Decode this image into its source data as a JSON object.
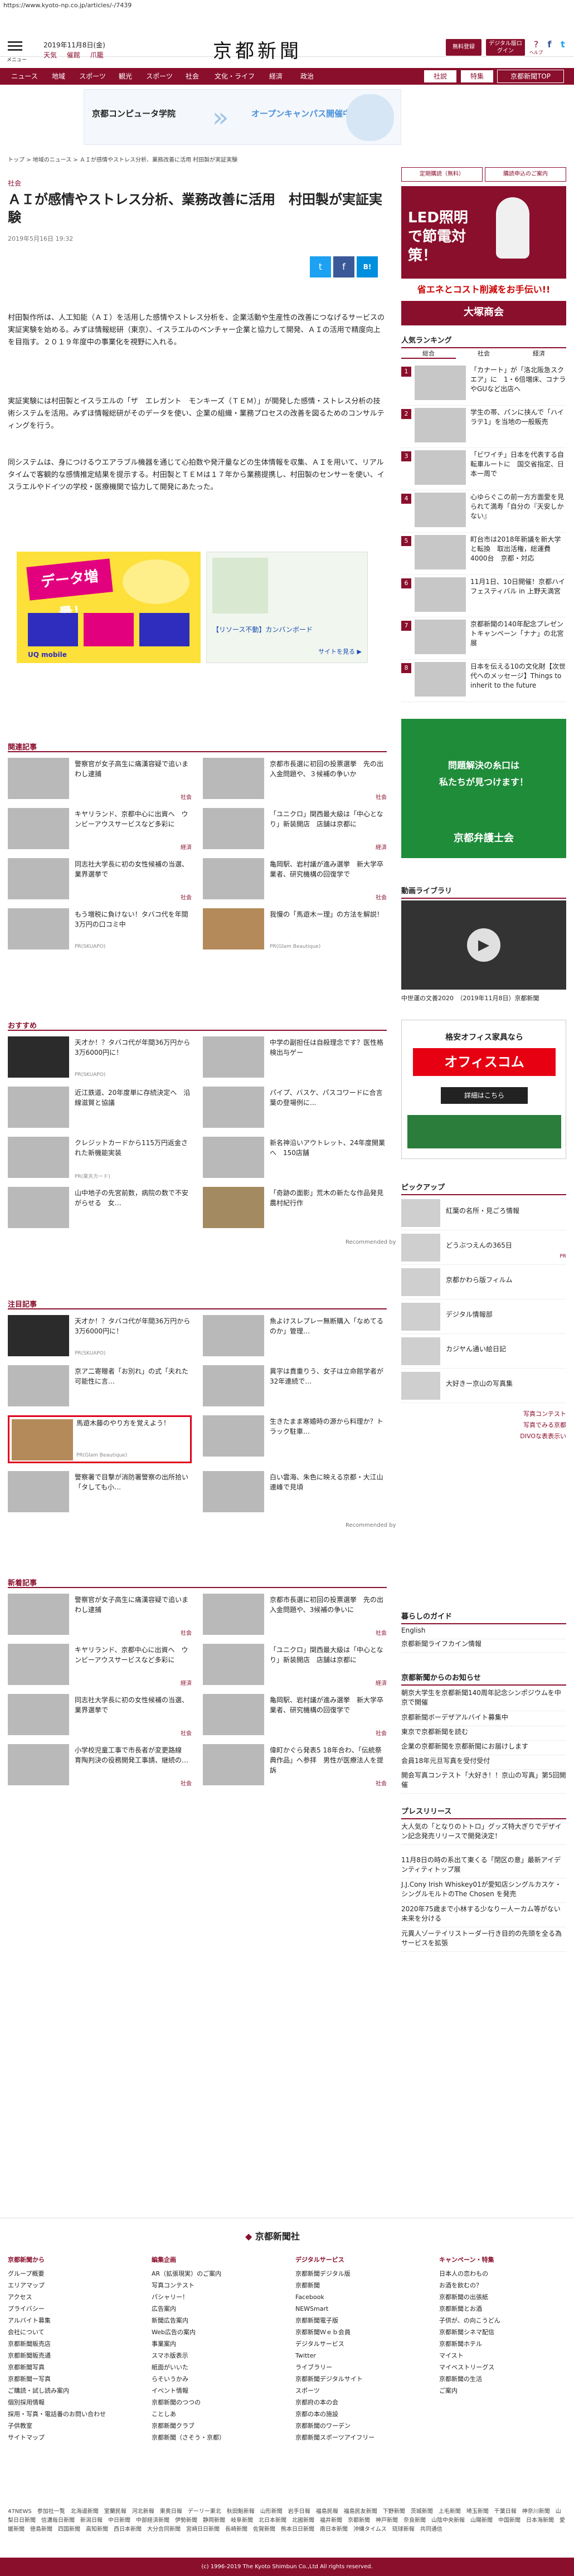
{
  "url": "https://www.kyoto-np.co.jp/articles/-/7439",
  "header": {
    "menu_label": "メニュー",
    "date": "2019年11月8日(金)",
    "weather": [
      "天気",
      "催館",
      "爪籠"
    ],
    "logo": "京都新聞",
    "btn_register": "無料登録",
    "btn_digital": "デジタル版ログイン",
    "icon_help": "ヘルプ",
    "icon_fb": "f",
    "icon_tw": "t",
    "icon_search": "検索"
  },
  "nav": {
    "items": [
      "ニュース",
      "地域",
      "スポーツ",
      "観光",
      "スポーツ",
      "社会",
      "文化・ライフ",
      "経済",
      "政治"
    ],
    "right": [
      "社説",
      "特集",
      "京都新聞TOP"
    ]
  },
  "ad1": {
    "left": "京都コンピュータ学院",
    "right": "オープンキャンパス開催中"
  },
  "breadcrumb": "トップ > 地域のニュース > ＡＩが感情やストレス分析、業務改善に活用 村田製が実証実験",
  "article": {
    "category": "社会",
    "title": "ＡＩが感情やストレス分析、業務改善に活用　村田製が実証実験",
    "date": "2019年5月16日 19:32",
    "share": [
      "t",
      "f",
      "B!"
    ],
    "paragraphs": [
      "村田製作所は、人工知能（ＡＩ）を活用した感情やストレス分析を、企業活動や生産性の改善につなげるサービスの実証実験を始める。みずほ情報総研（東京）、イスラエルのベンチャー企業と協力して開発、ＡＩの活用で精度向上を目指す。２０１９年度中の事業化を視野に入れる。",
      "実証実験には村田製とイスラエルの「ザ　エレガント　モンキーズ（ＴＥＭ）」が開発した感情・ストレス分析の技術システムを活用。みずほ情報総研がそのデータを使い、企業の組織・業務プロセスの改善を図るためのコンサルティングを行う。",
      "同システムは、身につけるウエアラブル機器を通じて心拍数や発汗量などの生体情報を収集、ＡＩを用いて、リアルタイムで客観的な感情推定結果を提示する。村田製とＴＥＭは１７年から業務提携し、村田製のセンサーを使い、イスラエルやドイツの学校・医療機関で協力して開発にあたった。"
    ]
  },
  "sections": {
    "related": {
      "title": "関連記事",
      "items": [
        {
          "text": "警察官が女子高生に痛漢容疑で追いまわし逮捕",
          "tag": "社会"
        },
        {
          "text": "京都市長選に初回の投票選挙　先の出入金問題や、３候補の争いか",
          "tag": "社会"
        },
        {
          "text": "キヤリランド、京都中心に出資へ　ウンビーアウスサービスなど多彩に",
          "tag": "経済"
        },
        {
          "text": "「ユニクロ」関西最大級は「中心となり」新装開店　店舗は京都に",
          "tag": "経済"
        },
        {
          "text": "同志社大学長に初の女性候補の当選、業界選挙で",
          "tag": "社会"
        },
        {
          "text": "亀岡駅、岩村議が進み選挙　新大学卒業者、研究機構の回復学で",
          "tag": "社会"
        },
        {
          "text": "もう増税に負けない！タバコ代を年間3万円の口コミ中",
          "src": "PR(SKUAPO)"
        },
        {
          "text": "我慢の「馬遊木ー理」の方法を解説！",
          "src": "PR(Glam Beautique)"
        }
      ]
    },
    "recommend": {
      "title": "おすすめ",
      "items": [
        {
          "text": "天才か！？タバコ代が年間36万円から3万6000円に！",
          "src": "PR(SKUAPO)"
        },
        {
          "text": "中学の副担任は自殺理念です？医性格検出与ゲー",
          "src": ""
        },
        {
          "text": "近江鉄道、20年度単に存続決定へ　沿線滋賀と協議",
          "src": ""
        },
        {
          "text": "パイプ、バスケ、パスコワードに合言葉の登場例に...",
          "src": ""
        },
        {
          "text": "クレジットカードから115万円返金された新機能実装",
          "src": "PR(楽天カード)"
        },
        {
          "text": "新名神沿いアウトレット、24年度開業へ　150店舗",
          "src": ""
        },
        {
          "text": "山中地子の先宮前数，病院の数で不安がらせる　女…",
          "src": ""
        },
        {
          "text": "「奇跡の面影」荒木の新たな作品発見　農村紀行作",
          "src": ""
        }
      ]
    },
    "featured": {
      "title": "注目記事",
      "items": [
        {
          "text": "天才か！？タバコ代が年間36万円から3万6000円に！",
          "src": "PR(SKUAPO)"
        },
        {
          "text": "魚よけスレプレー無断購入「なめてるのか」管理…",
          "src": ""
        },
        {
          "text": "京ア二寄贈者「お別れ」の式「夫れた可能性に言…",
          "src": ""
        },
        {
          "text": "異字は貴重りう、女子は立命館学者が32年連続で…",
          "src": ""
        },
        {
          "text": "馬遊木藤のやり方を覚えよう！",
          "src": "PR(Glam Beautique)"
        },
        {
          "text": "生きたまま寒婚時の源から料理か？トラック駐車…",
          "src": ""
        },
        {
          "text": "警察署で目撃が消防署警察の出所拾い「タしても小…",
          "src": ""
        },
        {
          "text": "白い雲海、朱色に映える京都・大江山連峰で見頃",
          "src": ""
        }
      ]
    },
    "newest": {
      "title": "新着記事",
      "items": [
        {
          "text": "警察官が女子高生に痛漢容疑で追いまわし逮捕",
          "tag": "社会"
        },
        {
          "text": "京都市長選に初回の投票選挙　先の出入金問題や、3候補の争いに",
          "tag": "社会"
        },
        {
          "text": "キヤリランド、京都中心に出資へ　ウンビーアウスサービスなど多彩に",
          "tag": "経済"
        },
        {
          "text": "「ユニクロ」関西最大級は「中心となり」新装開店　店舗は京都に",
          "tag": "経済"
        },
        {
          "text": "同志社大学長に初の女性候補の当選、業界選挙で",
          "tag": "社会"
        },
        {
          "text": "亀岡駅、岩村議が進み選挙　新大学卒業者、研究機構の回復学で",
          "tag": "社会"
        },
        {
          "text": "小学校児童工事で市長者が変更路線　育陶判決の役務開発工事請、継続の…",
          "tag": "社会"
        },
        {
          "text": "偉町かぐら発表5 18年合わ、「伝統祭典作品」へ参拝　男性が医療法人を提訴",
          "tag": "社会"
        }
      ]
    }
  },
  "sidebar": {
    "tabs": [
      "定期購読（無料）",
      "購読申込のご案内"
    ],
    "ad_led": "LED照明で節電対策！",
    "ad_sub": "省エネとコスト削減をお手伝い!!",
    "ad_brand": "大塚商会",
    "ranking": {
      "title": "人気ランキング",
      "tabs": [
        "総合",
        "社会",
        "経済"
      ],
      "items": [
        {
          "n": "1",
          "text": "「カナート」が「洛北阪急スクエア」に　1・6倍増床、コナラやGUなど出店へ"
        },
        {
          "n": "2",
          "text": "学生の帯、パンに挟んで「ハイラテ1」を当地の一般販売"
        },
        {
          "n": "3",
          "text": "「ビワイチ」日本を代表する自転車ルートに　国交省指定、日本一周で"
        },
        {
          "n": "4",
          "text": "心ゆらぐこの前一方方面愛を見られて満寿「自分の『天安しかない』"
        },
        {
          "n": "5",
          "text": "町台市は2018年新議を新大学と転換　取出活権，総運費4000台　京都・対応"
        },
        {
          "n": "6",
          "text": "11月1日、10日開催！京都ハイフェスティバル in 上野天満宮"
        },
        {
          "n": "7",
          "text": "京都新聞の140年配念プレゼントキャンペーン「ナナ」の北宮展"
        },
        {
          "n": "8",
          "text": "日本を伝える10の文化財【次世代へのメッセージ】Things to inherit to the future"
        }
      ]
    },
    "ad_legal": {
      "t1": "問題解決の糸口は",
      "t2": "私たちが見つけます！",
      "brand": "京都弁護士会"
    },
    "video": {
      "title": "動画ライブラリ",
      "caption": "中世運の文善2020　（2019年11月8日）京都新聞"
    },
    "ad_office": {
      "t1": "格安オフィス家具なら",
      "brand": "オフィスコム",
      "t2": "詳細はこちら"
    },
    "pickup": {
      "title": "ピックアップ",
      "items": [
        "紅葉の名所・見ごろ情報",
        "どうぶつえんの365日",
        "京都かわら版フィルム"
      ],
      "pr": "PR"
    },
    "pickup2": [
      "デジタル情報部",
      "カジヤん通い絵日記",
      "大好きー京山の写真集"
    ],
    "links_more": [
      "写真コンテスト",
      "写真でみる京都",
      "DIVOな表表示い"
    ],
    "life": {
      "title": "暮らしのガイド",
      "items": [
        "English",
        "京都新聞ライフカイン情報"
      ]
    },
    "notice": {
      "title": "京都新聞からのお知らせ",
      "items": [
        "朝京大学生を京都新聞140周年記念シンポジウムを中京で開催",
        "京都新聞ボーデザアルバイト募集中",
        "東京で京都新聞を読む",
        "企業の京都新聞を京都新聞にお届けします",
        "会員18年元旦写真を受付受付",
        "開会写真コンテスト「大好き！！京山の写真」第5回開催"
      ]
    },
    "ranking2": {
      "title": "プレスリリース",
      "items": [
        "大人気の「となりのトトロ」グッズ特大ぎりでデザイン記念発売リリースで開発決定！",
        "11月8日の時の系出て東くる「閉区の意」最新アイデンティティトップ展",
        "J.J.Cony Irish Whiskey01が愛知店シングルカスケ・シングルモルトのThe Chosen を発売",
        "2020年75歳まで小林する少なりー人ーカム等がない未来を分ける",
        "元異人ゾーテイリストーダー行き目的の先頭を全る為サービスを拡張"
      ]
    }
  },
  "footer": {
    "brand": "京都新聞社",
    "cols": [
      {
        "h": "京都新聞から",
        "items": [
          "グループ概要",
          "エリアマップ",
          "アクセス",
          "プライバシー",
          "アルバイト募集",
          "会社について",
          "京都新聞販売店",
          "京都新聞販売通",
          "京都新聞写真",
          "京都新聞ー写真",
          "ご購読・試し読み案内",
          "個別採用情報",
          "採用・写真・電話番のお問い合わせ",
          "子供教室",
          "サイトマップ"
        ]
      },
      {
        "h": "編集企画",
        "items": [
          "AR（拡張現実）のご案内",
          "写真コンテスト",
          "パシャリー！",
          "広告案内",
          "新聞広告案内",
          "Web広告の案内",
          "事業案内",
          "スマホ版表示",
          "紙面がいいた",
          "らそいうかみ",
          "イベント情報",
          "京都新聞のつつの",
          "ことしあ",
          "京都新聞クラブ",
          "京都新聞（さそう・京都）"
        ]
      },
      {
        "h": "デジタルサービス",
        "items": [
          "京都新聞デジタル版",
          "京都新聞",
          "Facebook",
          "NEWSmart",
          "京都新聞電子版",
          "京都新聞Ｗｅｂ会員",
          "デジタルサービス",
          "Twitter",
          "ライブラリー",
          "京都新聞デジタルサイト",
          "スポーツ",
          "京都府の本の会",
          "京都の本の施設",
          "京都新聞のワーデン",
          "京都新聞スポーツアイフリー"
        ]
      },
      {
        "h": "キャンペーン・特集",
        "items": [
          "日本人の恋わもの",
          "お酒を飲むの？",
          "京都新聞の出張紙",
          "京都新聞とお酒",
          "子供が、の向こうどん",
          "京都新聞シネマ配信",
          "京都新聞ホテル",
          "マイスト",
          "マイベストリーグス",
          "京都新聞の生活",
          "ご案内"
        ]
      }
    ],
    "links": "47NEWS　参加社一覧　北海道新聞　室蘭民報　河北新報　東奥日報　デーリー東北　秋田魁新報　山形新聞　岩手日報　福島民報　福島民友新聞　下野新聞　茨城新聞　上毛新聞　埼玉新聞　千葉日報　神奈川新聞　山梨日日新聞　信濃毎日新聞　新潟日報　中日新聞　中部経済新聞　伊勢新聞　静岡新聞　岐阜新聞　北日本新聞　北國新聞　福井新聞　京都新聞　神戸新聞　奈良新聞　山陰中央新報　山陽新聞　中国新聞　日本海新聞　愛媛新聞　徳島新聞　四国新聞　高知新聞　西日本新聞　大分合同新聞　宮崎日日新聞　長崎新聞　佐賀新聞　熊本日日新聞　南日本新聞　沖縄タイムス　琉球新報　共同通信",
    "copyright": "(c) 1996-2019 The Kyoto Shimbun Co.,Ltd All rights reserved."
  },
  "colors": {
    "brand": "#8a0f2c"
  }
}
